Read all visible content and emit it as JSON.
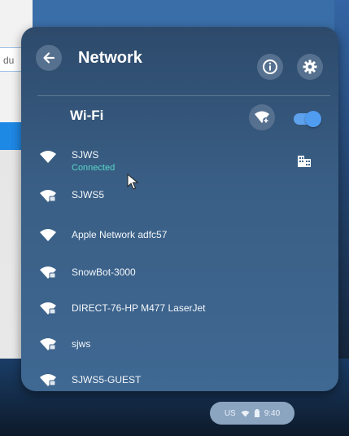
{
  "background": {
    "input_fragment": "du"
  },
  "header": {
    "title": "Network"
  },
  "wifi": {
    "label": "Wi-Fi",
    "enabled": true
  },
  "networks": [
    {
      "name": "SJWS",
      "status": "Connected",
      "secured": false
    },
    {
      "name": "SJWS5",
      "secured": true
    },
    {
      "name": "Apple Network adfc57",
      "secured": false
    },
    {
      "name": "SnowBot-3000",
      "secured": true
    },
    {
      "name": "DIRECT-76-HP M477 LaserJet",
      "secured": true
    },
    {
      "name": "sjws",
      "secured": true
    },
    {
      "name": "SJWS5-GUEST",
      "secured": true
    }
  ],
  "status_bar": {
    "locale": "US",
    "time": "9:40"
  },
  "colors": {
    "accent": "#4f9cf0",
    "connected": "#5ad7c9"
  },
  "icons": [
    "back-arrow-icon",
    "info-icon",
    "gear-icon",
    "add-network-icon",
    "wifi-icon",
    "wifi-locked-icon",
    "building-icon",
    "battery-icon",
    "cursor-icon"
  ]
}
